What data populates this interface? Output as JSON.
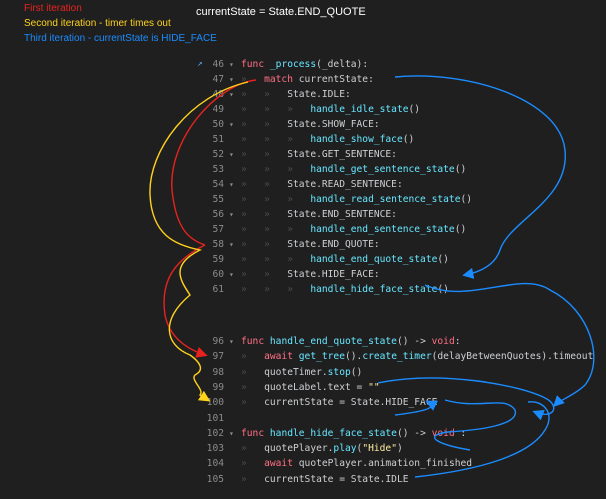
{
  "legend": {
    "first": "First iteration",
    "second": "Second iteration - timer times out",
    "third": "Third iteration - currentState is HIDE_FACE"
  },
  "header": {
    "state_text": "currentState = State.END_QUOTE"
  },
  "colors": {
    "first": "#e8231f",
    "second": "#ffd21c",
    "third": "#1b8cff"
  },
  "gutter_icon": "jump-to-definition-icon",
  "code": {
    "block1": [
      {
        "n": "46",
        "fold": "▾",
        "ind": 0,
        "parts": [
          [
            "kw",
            "func "
          ],
          [
            "fn",
            "_process"
          ],
          [
            "sym",
            "(_delta):"
          ]
        ]
      },
      {
        "n": "47",
        "fold": "▾",
        "ind": 1,
        "parts": [
          [
            "kw",
            "match "
          ],
          [
            "id",
            "currentState:"
          ]
        ]
      },
      {
        "n": "48",
        "fold": "▾",
        "ind": 2,
        "parts": [
          [
            "id",
            "State.IDLE:"
          ]
        ]
      },
      {
        "n": "49",
        "fold": "",
        "ind": 3,
        "parts": [
          [
            "fn",
            "handle_idle_state"
          ],
          [
            "sym",
            "()"
          ]
        ]
      },
      {
        "n": "50",
        "fold": "▾",
        "ind": 2,
        "parts": [
          [
            "id",
            "State.SHOW_FACE:"
          ]
        ]
      },
      {
        "n": "51",
        "fold": "",
        "ind": 3,
        "parts": [
          [
            "fn",
            "handle_show_face"
          ],
          [
            "sym",
            "()"
          ]
        ]
      },
      {
        "n": "52",
        "fold": "▾",
        "ind": 2,
        "parts": [
          [
            "id",
            "State.GET_SENTENCE:"
          ]
        ]
      },
      {
        "n": "53",
        "fold": "",
        "ind": 3,
        "parts": [
          [
            "fn",
            "handle_get_sentence_state"
          ],
          [
            "sym",
            "()"
          ]
        ]
      },
      {
        "n": "54",
        "fold": "▾",
        "ind": 2,
        "parts": [
          [
            "id",
            "State.READ_SENTENCE:"
          ]
        ]
      },
      {
        "n": "55",
        "fold": "",
        "ind": 3,
        "parts": [
          [
            "fn",
            "handle_read_sentence_state"
          ],
          [
            "sym",
            "()"
          ]
        ]
      },
      {
        "n": "56",
        "fold": "▾",
        "ind": 2,
        "parts": [
          [
            "id",
            "State.END_SENTENCE:"
          ]
        ]
      },
      {
        "n": "57",
        "fold": "",
        "ind": 3,
        "parts": [
          [
            "fn",
            "handle_end_sentence_state"
          ],
          [
            "sym",
            "()"
          ]
        ]
      },
      {
        "n": "58",
        "fold": "▾",
        "ind": 2,
        "parts": [
          [
            "id",
            "State.END_QUOTE:"
          ]
        ]
      },
      {
        "n": "59",
        "fold": "",
        "ind": 3,
        "parts": [
          [
            "fn",
            "handle_end_quote_state"
          ],
          [
            "sym",
            "()"
          ]
        ]
      },
      {
        "n": "60",
        "fold": "▾",
        "ind": 2,
        "parts": [
          [
            "id",
            "State.HIDE_FACE:"
          ]
        ]
      },
      {
        "n": "61",
        "fold": "",
        "ind": 3,
        "parts": [
          [
            "fn",
            "handle_hide_face_state"
          ],
          [
            "sym",
            "()"
          ]
        ]
      }
    ],
    "block2": [
      {
        "n": "96",
        "fold": "▾",
        "ind": 0,
        "parts": [
          [
            "kw",
            "func "
          ],
          [
            "fn",
            "handle_end_quote_state"
          ],
          [
            "sym",
            "() -> "
          ],
          [
            "kw",
            "void"
          ],
          [
            "sym",
            ":"
          ]
        ]
      },
      {
        "n": "97",
        "fold": "",
        "ind": 1,
        "parts": [
          [
            "kw",
            "await "
          ],
          [
            "fn",
            "get_tree"
          ],
          [
            "sym",
            "()."
          ],
          [
            "fn",
            "create_timer"
          ],
          [
            "sym",
            "(delayBetweenQuotes).timeout"
          ]
        ]
      },
      {
        "n": "98",
        "fold": "",
        "ind": 1,
        "parts": [
          [
            "id",
            "quoteTimer."
          ],
          [
            "fn",
            "stop"
          ],
          [
            "sym",
            "()"
          ]
        ]
      },
      {
        "n": "99",
        "fold": "",
        "ind": 1,
        "parts": [
          [
            "id",
            "quoteLabel.text = "
          ],
          [
            "str",
            "\"\""
          ]
        ]
      },
      {
        "n": "100",
        "fold": "",
        "ind": 1,
        "parts": [
          [
            "id",
            "currentState = State.HIDE_FACE"
          ]
        ]
      },
      {
        "n": "101",
        "fold": "",
        "ind": 0,
        "parts": []
      },
      {
        "n": "102",
        "fold": "▾",
        "ind": 0,
        "parts": [
          [
            "kw",
            "func "
          ],
          [
            "fn",
            "handle_hide_face_state"
          ],
          [
            "sym",
            "() -> "
          ],
          [
            "kw",
            "void"
          ],
          [
            "sym",
            " :"
          ]
        ]
      },
      {
        "n": "103",
        "fold": "",
        "ind": 1,
        "parts": [
          [
            "id",
            "quotePlayer."
          ],
          [
            "fn",
            "play"
          ],
          [
            "sym",
            "("
          ],
          [
            "str",
            "\"Hide\""
          ],
          [
            "sym",
            ")"
          ]
        ]
      },
      {
        "n": "104",
        "fold": "",
        "ind": 1,
        "parts": [
          [
            "kw",
            "await "
          ],
          [
            "id",
            "quotePlayer.animation_finished"
          ]
        ]
      },
      {
        "n": "105",
        "fold": "",
        "ind": 1,
        "parts": [
          [
            "id",
            "currentState = State.IDLE"
          ]
        ]
      }
    ]
  }
}
